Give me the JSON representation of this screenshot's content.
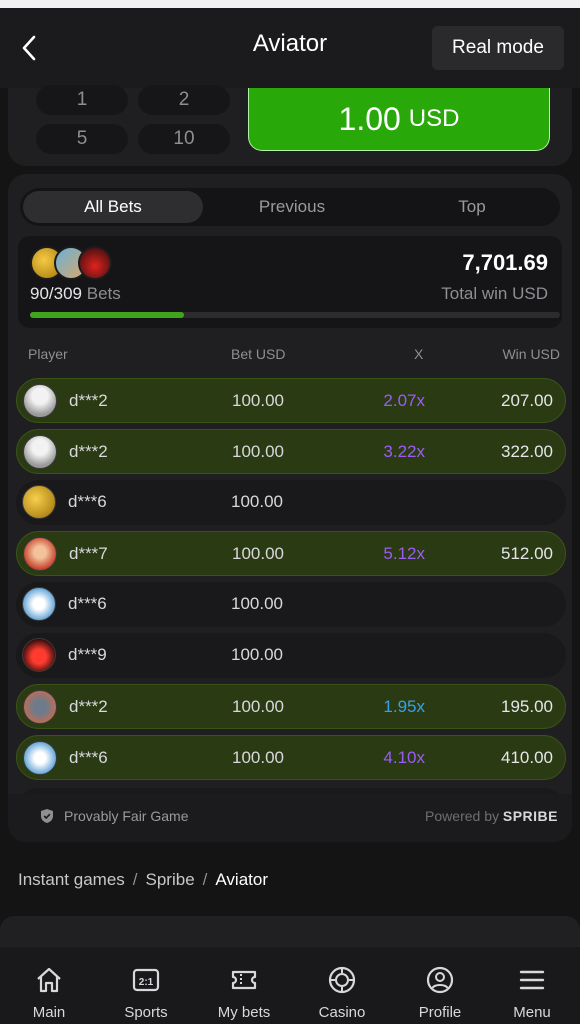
{
  "header": {
    "title": "Aviator",
    "mode_label": "Real mode",
    "back_icon": "chevron-left-icon"
  },
  "bet_panel": {
    "quick_amounts": [
      "1",
      "2",
      "5",
      "10"
    ],
    "amount": "1.00",
    "currency": "USD",
    "amount_color": "#28a909"
  },
  "tabs": [
    {
      "label": "All Bets",
      "active": true
    },
    {
      "label": "Previous",
      "active": false
    },
    {
      "label": "Top",
      "active": false
    }
  ],
  "summary": {
    "count": "90/309",
    "count_label": "Bets",
    "total": "7,701.69",
    "total_label": "Total win USD",
    "progress_fraction": 0.29
  },
  "table": {
    "headers": {
      "player": "Player",
      "bet": "Bet USD",
      "mult": "X",
      "win": "Win USD"
    },
    "rows": [
      {
        "player": "d***2",
        "bet": "100.00",
        "mult": "2.07x",
        "win": "207.00",
        "won": true,
        "mult_color": "#9b5cf6",
        "avatar": "eagle"
      },
      {
        "player": "d***2",
        "bet": "100.00",
        "mult": "3.22x",
        "win": "322.00",
        "won": true,
        "mult_color": "#9b5cf6",
        "avatar": "eagle"
      },
      {
        "player": "d***6",
        "bet": "100.00",
        "mult": "",
        "win": "",
        "won": false,
        "mult_color": "#9b5cf6",
        "avatar": "gold"
      },
      {
        "player": "d***7",
        "bet": "100.00",
        "mult": "5.12x",
        "win": "512.00",
        "won": true,
        "mult_color": "#9b5cf6",
        "avatar": "cat"
      },
      {
        "player": "d***6",
        "bet": "100.00",
        "mult": "",
        "win": "",
        "won": false,
        "mult_color": "#9b5cf6",
        "avatar": "plane"
      },
      {
        "player": "d***9",
        "bet": "100.00",
        "mult": "",
        "win": "",
        "won": false,
        "mult_color": "#9b5cf6",
        "avatar": "car"
      },
      {
        "player": "d***2",
        "bet": "100.00",
        "mult": "1.95x",
        "win": "195.00",
        "won": true,
        "mult_color": "#35a2e8",
        "avatar": "dragon"
      },
      {
        "player": "d***6",
        "bet": "100.00",
        "mult": "4.10x",
        "win": "410.00",
        "won": true,
        "mult_color": "#9b5cf6",
        "avatar": "plane"
      }
    ]
  },
  "footer": {
    "fair_label": "Provably Fair Game",
    "powered_label": "Powered by",
    "brand": "SPRIBE"
  },
  "breadcrumb": {
    "items": [
      "Instant games",
      "Spribe",
      "Aviator"
    ]
  },
  "bottom_nav": [
    {
      "label": "Main",
      "icon": "home-icon"
    },
    {
      "label": "Sports",
      "icon": "sports-icon"
    },
    {
      "label": "My bets",
      "icon": "ticket-icon"
    },
    {
      "label": "Casino",
      "icon": "casino-chip-icon"
    },
    {
      "label": "Profile",
      "icon": "profile-icon"
    },
    {
      "label": "Menu",
      "icon": "menu-icon"
    }
  ]
}
